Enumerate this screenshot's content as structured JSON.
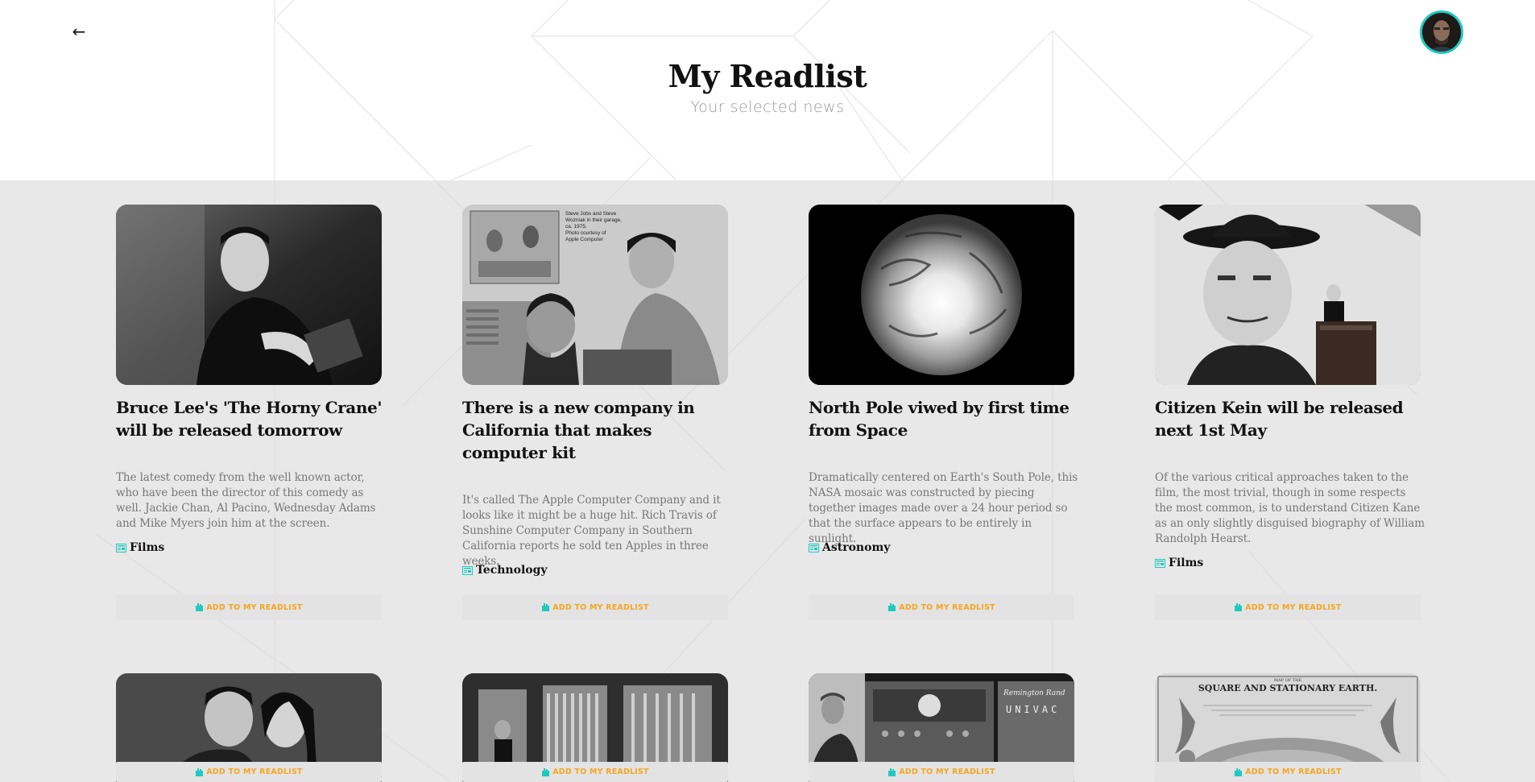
{
  "header": {
    "title": "My Readlist",
    "subtitle": "Your selected news",
    "back_icon": "←"
  },
  "accent_color": "#1ec9c0",
  "button_color": "#f5a623",
  "cards": [
    {
      "title": "Bruce Lee's 'The Horny Crane' will be released tomorrow",
      "description": "The latest comedy from the well known actor, who have been the director of this comedy as well. Jackie Chan, Al Pacino, Wednesday Adams and Mike Myers join him at the screen.",
      "category": "Films",
      "button": "ADD TO MY READLIST"
    },
    {
      "title": "There is a new company in California that makes computer kit",
      "description": "It's called The Apple Computer Company and it looks like it might be a huge hit. Rich Travis of Sunshine Computer Company in Southern California reports he sold ten Apples in three weeks.",
      "category": "Technology",
      "button": "ADD TO MY READLIST",
      "image_caption": [
        "Steve Jobs and Steve",
        "Wozniak in their garage,",
        "ca. 1975.",
        "Photo courtesy of",
        "Apple Computer"
      ]
    },
    {
      "title": "North Pole viwed by first time from Space",
      "description": "Dramatically centered on Earth's South Pole, this NASA mosaic was constructed by piecing together images made over a 24 hour period so that the surface appears to be entirely in sunlight.",
      "category": "Astronomy",
      "button": "ADD TO MY READLIST"
    },
    {
      "title": "Citizen Kein will be released next 1st May",
      "description": "Of the various critical approaches taken to the film, the most trivial, though in some respects the most common, is to understand Citizen Kane as an only slightly disguised biography of William Randolph Hearst.",
      "category": "Films",
      "button": "ADD TO MY READLIST"
    }
  ],
  "row2_buttons": [
    "ADD TO MY READLIST",
    "ADD TO MY READLIST",
    "ADD TO MY READLIST",
    "ADD TO MY READLIST"
  ],
  "row2_images": {
    "remington_text": "Remington Rand",
    "univac_text": "UNIVAC",
    "map_title": "SQUARE AND STATIONARY EARTH.",
    "map_supertitle": "MAP OF THE"
  }
}
